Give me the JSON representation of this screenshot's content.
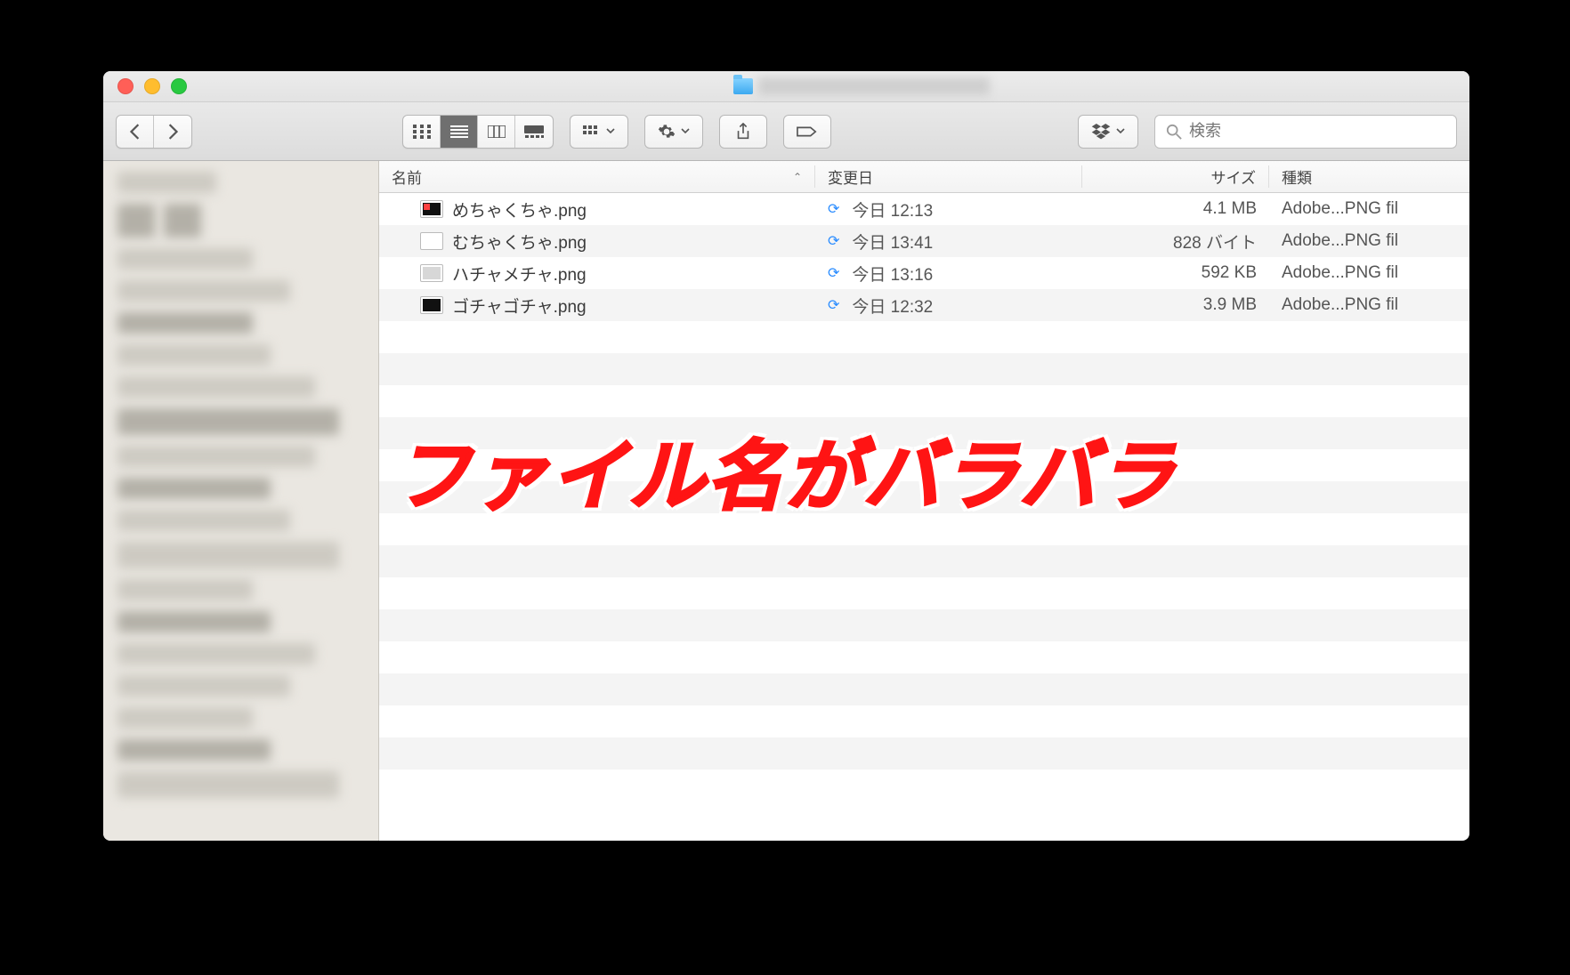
{
  "columns": {
    "name": "名前",
    "modified": "変更日",
    "size": "サイズ",
    "kind": "種類"
  },
  "search": {
    "placeholder": "検索"
  },
  "files": [
    {
      "name": "めちゃくちゃ.png",
      "modified": "今日 12:13",
      "size": "4.1 MB",
      "kind": "Adobe...PNG fil",
      "thumb": "red"
    },
    {
      "name": "むちゃくちゃ.png",
      "modified": "今日 13:41",
      "size": "828 バイト",
      "kind": "Adobe...PNG fil",
      "thumb": "plain"
    },
    {
      "name": "ハチャメチャ.png",
      "modified": "今日 13:16",
      "size": "592 KB",
      "kind": "Adobe...PNG fil",
      "thumb": "gray"
    },
    {
      "name": "ゴチャゴチャ.png",
      "modified": "今日 12:32",
      "size": "3.9 MB",
      "kind": "Adobe...PNG fil",
      "thumb": "dark"
    }
  ],
  "overlay_text": "ファイル名がバラバラ"
}
